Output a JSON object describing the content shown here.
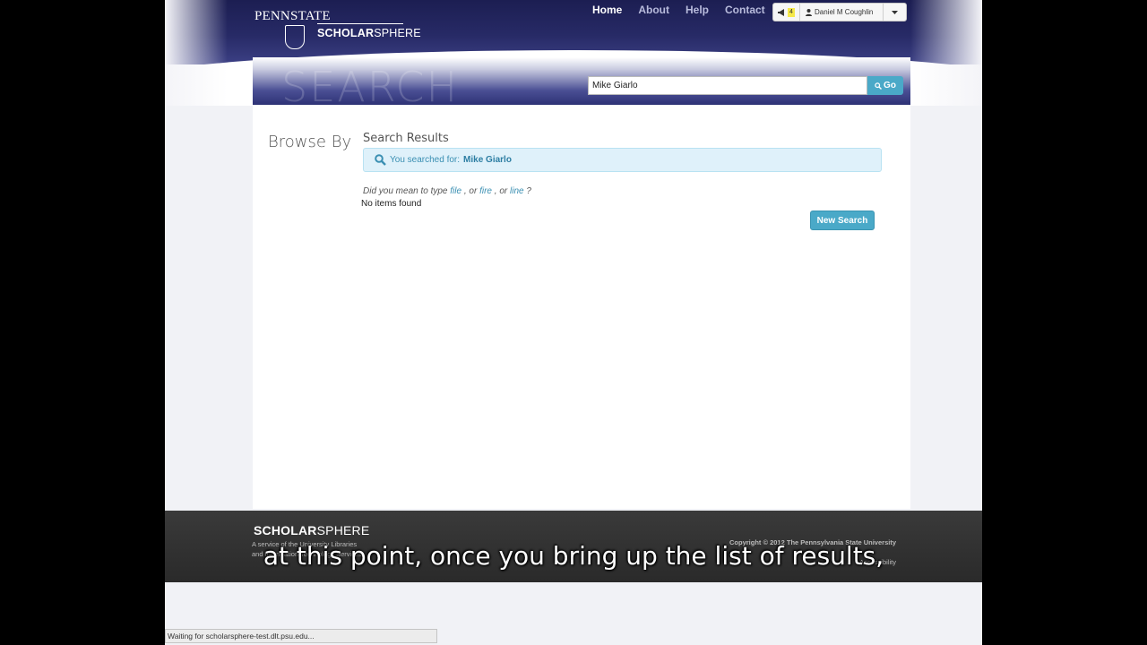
{
  "logo": {
    "pennstate": "PENNSTATE",
    "sphere_bold": "SCHOLAR",
    "sphere_rest": "SPHERE"
  },
  "nav": {
    "items": [
      "Home",
      "About",
      "Help",
      "Contact"
    ]
  },
  "user": {
    "notifications": "4",
    "name": "Daniel M Coughlin"
  },
  "search": {
    "watermark": "SEARCH",
    "value": "Mike Giarlo",
    "go_label": "Go"
  },
  "browse_by": "Browse By",
  "results": {
    "title": "Search Results",
    "searched_prefix": "You searched for:",
    "searched_term": "Mike Giarlo",
    "did_you_mean_prefix": "Did you mean to type",
    "suggestions": [
      "file",
      "fire",
      "line"
    ],
    "no_items": "No items found",
    "new_search_label": "New Search"
  },
  "footer": {
    "logo_bold": "SCHOLAR",
    "logo_rest": "SPHERE",
    "service_line1": "A service of the University Libraries",
    "service_line2": "and Information Technology Services",
    "copyright": "Copyright © 2012 The Pennsylvania State University",
    "accessibility": "Accessibility"
  },
  "caption": "at this point, once you bring up the list of results,",
  "status_bar": "Waiting for scholarsphere-test.dlt.psu.edu...",
  "colors": {
    "accent": "#4aa9c8",
    "header": "#272a66",
    "footer": "#2f2f2f"
  }
}
